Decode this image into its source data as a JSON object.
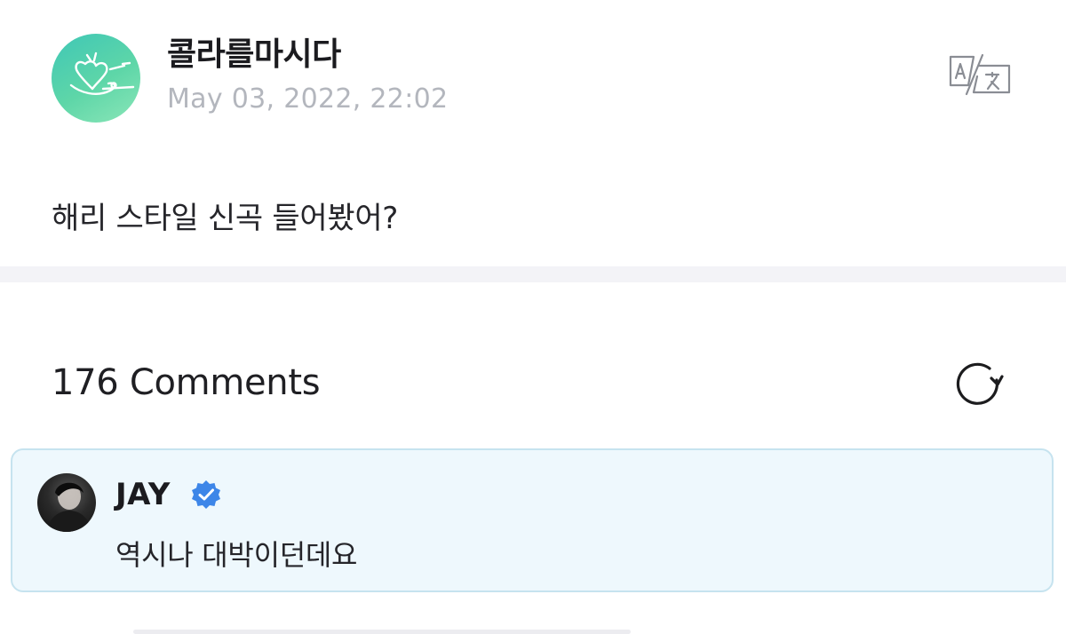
{
  "post": {
    "author": "콜라를마시다",
    "date": "May 03, 2022, 22:02",
    "body": "해리 스타일 신곡 들어봤어?",
    "avatar_icon": "heart-doodle-avatar",
    "translate_icon": "translate-icon"
  },
  "comments": {
    "count_label": "176 Comments",
    "refresh_icon": "refresh-icon",
    "items": [
      {
        "author": "JAY",
        "verified": true,
        "text": "역시나 대박이던데요",
        "highlight_color": "#eef8fd"
      }
    ]
  },
  "colors": {
    "verified_badge": "#3d86e8",
    "avatar_gradient_start": "#3fc7b6",
    "avatar_gradient_end": "#8be6b8",
    "muted_text": "#b3b6bd"
  }
}
